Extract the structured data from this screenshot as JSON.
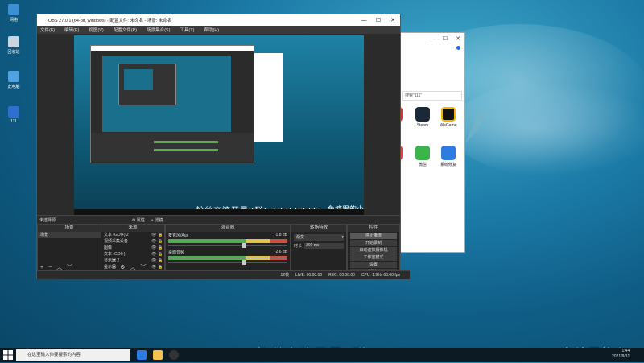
{
  "desktop": {
    "icons": [
      {
        "label": "网络",
        "icon": "network-icon"
      },
      {
        "label": "回收站",
        "icon": "recycle-bin-icon"
      },
      {
        "label": "此电脑",
        "icon": "computer-icon"
      },
      {
        "label": "111",
        "icon": "file-icon"
      }
    ],
    "overlay_text": "、粉丝交流开黑Q群：187652711",
    "overlay_text_right": "鱼塘里的小"
  },
  "second_window": {
    "search_placeholder": "搜索\"111\"",
    "apps": [
      {
        "label": "Steam",
        "icon": "steam-icon"
      },
      {
        "label": "WeGame",
        "icon": "wegame-icon"
      },
      {
        "label": "微信",
        "icon": "wechat-icon"
      },
      {
        "label": "系统修复",
        "icon": "system-repair-icon"
      }
    ],
    "partial_labels": [
      "me",
      "映"
    ]
  },
  "obs": {
    "title": "OBS 27.0.1 (64-bit, windows) - 配置文件: 未命名 - 场景: 未命名",
    "menu": [
      "文件(F)",
      "编辑(E)",
      "视图(V)",
      "配置文件(P)",
      "场景集合(S)",
      "工具(T)",
      "帮助(H)"
    ],
    "preview_overlay": "、粉丝交流开黑Q群：187652711",
    "preview_overlay_right": "鱼塘里的小",
    "source_bar": {
      "selected": "未选择源",
      "properties": "属性",
      "filters": "滤镜"
    },
    "scenes": {
      "header": "场景",
      "items": [
        "场景"
      ]
    },
    "sources": {
      "header": "来源",
      "items": [
        "文本 (GDI+) 2",
        "视频采集设备",
        "图像",
        "文本 (GDI+)",
        "显示器 2",
        "显示器"
      ]
    },
    "mixer": {
      "header": "混音器",
      "tracks": [
        {
          "name": "麦克风/Aux",
          "db": "-1.8 dB"
        },
        {
          "name": "桌面音频",
          "db": "-2.6 dB"
        }
      ]
    },
    "transitions": {
      "header": "转场特效",
      "type": "渐变",
      "duration_label": "时长",
      "duration": "300 ms"
    },
    "controls": {
      "header": "控件",
      "buttons": [
        "停止推流",
        "开始录制",
        "启动虚拟摄像机",
        "工作室模式",
        "设置",
        "退出"
      ]
    },
    "status": {
      "live": "LIVE: 00:00:00",
      "rec": "REC: 00:00:00",
      "cpu": "CPU: 1.9%, 60.00 fps",
      "dropped": "12帧"
    }
  },
  "taskbar": {
    "search_placeholder": "在这里输入你要搜索的内容",
    "clock_time": "1:44",
    "clock_date": "2021/8/31"
  }
}
